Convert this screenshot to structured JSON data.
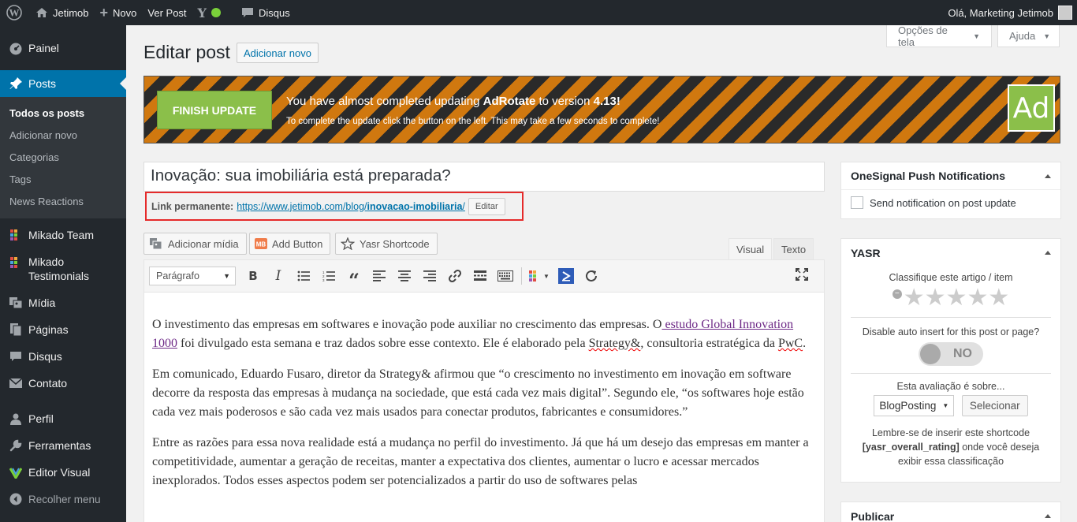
{
  "adminbar": {
    "site_name": "Jetimob",
    "new_label": "Novo",
    "view_post": "Ver Post",
    "disqus": "Disqus",
    "greeting": "Olá, Marketing Jetimob"
  },
  "sidebar": {
    "painel": "Painel",
    "posts": "Posts",
    "submenu": [
      "Todos os posts",
      "Adicionar novo",
      "Categorias",
      "Tags",
      "News Reactions"
    ],
    "mikado_team": "Mikado Team",
    "mikado_testimonials_1": "Mikado",
    "mikado_testimonials_2": "Testimonials",
    "midia": "Mídia",
    "paginas": "Páginas",
    "disqus": "Disqus",
    "contato": "Contato",
    "perfil": "Perfil",
    "ferramentas": "Ferramentas",
    "editor_visual": "Editor Visual",
    "recolher": "Recolher menu"
  },
  "screen_options": "Opções de tela",
  "help": "Ajuda",
  "page": {
    "title": "Editar post",
    "add_new": "Adicionar novo"
  },
  "banner": {
    "button": "FINISH UPDATE",
    "line1_a": "You have almost completed updating ",
    "line1_b": "AdRotate",
    "line1_c": " to version ",
    "line1_d": "4.13",
    "line1_e": "!",
    "line2": "To complete the update click the button on the left. This may take a few seconds to complete!",
    "logo": "Ad"
  },
  "post": {
    "title": "Inovação: sua imobiliária está preparada?",
    "permalink_label": "Link permanente:",
    "permalink_base": "https://www.jetimob.com/blog/",
    "permalink_slug": "inovacao-imobiliaria",
    "permalink_end": "/",
    "edit_button": "Editar"
  },
  "media_buttons": {
    "add_media": "Adicionar mídia",
    "add_button": "Add Button",
    "yasr_shortcode": "Yasr Shortcode"
  },
  "editor": {
    "tab_visual": "Visual",
    "tab_text": "Texto",
    "format": "Parágrafo",
    "p1_a": "O investimento das empresas em softwares e inovação pode auxiliar no crescimento das empresas. O",
    "p1_link": " estudo Global Innovation 1000",
    "p1_b": " foi divulgado esta semana e traz dados sobre esse contexto. Ele é elaborado pela ",
    "p1_c": "Strategy&",
    "p1_d": ", consultoria estratégica da ",
    "p1_e": "PwC",
    "p1_f": ".",
    "p2": "Em comunicado, Eduardo Fusaro, diretor da Strategy& afirmou que “o crescimento no investimento em inovação em software decorre da resposta das empresas à mudança na sociedade, que está cada vez mais digital”. Segundo ele, “os softwares hoje estão cada vez mais poderosos e são cada vez mais usados para conectar produtos, fabricantes e consumidores.”",
    "p3": "Entre as razões para essa nova realidade está a mudança no perfil do investimento. Já que há um desejo das empresas em manter a competitividade, aumentar a geração de receitas, manter a expectativa dos clientes, aumentar o lucro e acessar mercados inexplorados. Todos esses aspectos podem ser potencializados a partir do uso de softwares pelas"
  },
  "onesignal": {
    "title": "OneSignal Push Notifications",
    "checkbox": "Send notification on post update"
  },
  "yasr": {
    "title": "YASR",
    "rate_label": "Classifique este artigo / item",
    "disable_label": "Disable auto insert for this post or page?",
    "toggle": "NO",
    "about_label": "Esta avaliação é sobre...",
    "select_value": "BlogPosting",
    "select_button": "Selecionar",
    "reminder_1": "Lembre-se de inserir este shortcode",
    "reminder_code": "[yasr_overall_rating]",
    "reminder_2": " onde você deseja",
    "reminder_3": "exibir essa classificação"
  },
  "publish": {
    "title": "Publicar"
  },
  "colors": {
    "admin_bar": "#23282d",
    "accent": "#0073aa",
    "banner_orange": "#d0780f",
    "banner_green": "#8bbf4a",
    "permalink_highlight": "#e52a2a"
  }
}
